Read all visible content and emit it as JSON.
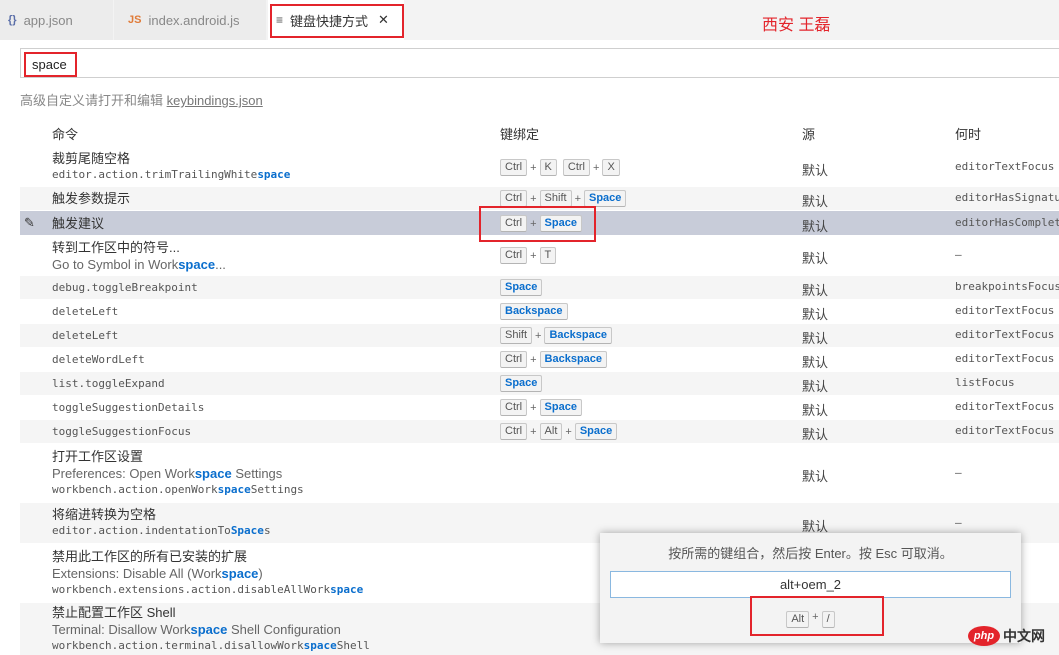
{
  "tabs": [
    {
      "icon": "{}",
      "label": "app.json"
    },
    {
      "icon": "JS",
      "label": "index.android.js"
    },
    {
      "icon": "≡",
      "label": "键盘快捷方式",
      "close": "✕"
    }
  ],
  "author_note": "西安 王磊",
  "search": {
    "value": "space"
  },
  "hint": {
    "text": "高级自定义请打开和编辑 ",
    "link": "keybindings.json"
  },
  "columns": {
    "command": "命令",
    "keybinding": "键绑定",
    "source": "源",
    "when": "何时"
  },
  "rows": [
    {
      "label": "裁剪尾随空格",
      "id_pre": "editor.action.trimTrailingWhite",
      "id_hl": "space",
      "id_post": "",
      "keys": [
        [
          "Ctrl",
          "K"
        ],
        [
          "Ctrl",
          "X"
        ]
      ],
      "source": "默认",
      "when": "editorTextFocus &&"
    },
    {
      "label": "触发参数提示",
      "keys": [
        [
          "Ctrl",
          "Shift",
          "Space"
        ]
      ],
      "source": "默认",
      "when": "editorHasSignatureHelp"
    },
    {
      "label": "触发建议",
      "keys": [
        [
          "Ctrl",
          "Space"
        ]
      ],
      "source": "默认",
      "when": "editorHasCompletionItemProvider"
    },
    {
      "label": "转到工作区中的符号...",
      "sub_pre": "Go to Symbol in Work",
      "sub_hl": "space",
      "sub_post": "...",
      "keys": [
        [
          "Ctrl",
          "T"
        ]
      ],
      "source": "默认",
      "when": "—"
    },
    {
      "id": "debug.toggleBreakpoint",
      "keys": [
        [
          "Space"
        ]
      ],
      "source": "默认",
      "when": "breakpointsFocused"
    },
    {
      "id": "deleteLeft",
      "keys": [
        [
          "Backspace"
        ]
      ],
      "source": "默认",
      "when": "editorTextFocus &&"
    },
    {
      "id": "deleteLeft",
      "keys": [
        [
          "Shift",
          "Backspace"
        ]
      ],
      "source": "默认",
      "when": "editorTextFocus &&"
    },
    {
      "id": "deleteWordLeft",
      "keys": [
        [
          "Ctrl",
          "Backspace"
        ]
      ],
      "source": "默认",
      "when": "editorTextFocus &&"
    },
    {
      "id": "list.toggleExpand",
      "keys": [
        [
          "Space"
        ]
      ],
      "source": "默认",
      "when": "listFocus"
    },
    {
      "id": "toggleSuggestionDetails",
      "keys": [
        [
          "Ctrl",
          "Space"
        ]
      ],
      "source": "默认",
      "when": "editorTextFocus &&"
    },
    {
      "id": "toggleSuggestionFocus",
      "keys": [
        [
          "Ctrl",
          "Alt",
          "Space"
        ]
      ],
      "source": "默认",
      "when": "editorTextFocus &&"
    },
    {
      "label": "打开工作区设置",
      "sub_pre": "Preferences: Open Work",
      "sub_hl": "space",
      "sub_post": " Settings",
      "id_pre": "workbench.action.openWork",
      "id_hl": "space",
      "id_post": "Settings",
      "keys": [],
      "source": "默认",
      "when": "—"
    },
    {
      "label": "将缩进转换为空格",
      "id_pre": "editor.action.indentationTo",
      "id_hl": "Space",
      "id_post": "s",
      "keys": [],
      "source": "默认",
      "when": "—"
    },
    {
      "label": "禁用此工作区的所有已安装的扩展",
      "sub_pre": "Extensions: Disable All (Work",
      "sub_hl": "space",
      "sub_post": ")",
      "id_pre": "workbench.extensions.action.disableAllWork",
      "id_hl": "space",
      "id_post": "",
      "keys": [],
      "source": "",
      "when": ""
    },
    {
      "label": "禁止配置工作区 Shell",
      "sub_pre": "Terminal: Disallow Work",
      "sub_hl": "space",
      "sub_post": " Shell Configuration",
      "id_pre": "workbench.action.terminal.disallowWork",
      "id_hl": "space",
      "id_post": "Shell",
      "keys": [],
      "source": "",
      "when": ""
    }
  ],
  "dialog": {
    "message": "按所需的键组合，然后按 Enter。按 Esc 可取消。",
    "input": "alt+oem_2",
    "keys": [
      "Alt",
      "/"
    ]
  },
  "watermark": {
    "logo": "php",
    "text": "中文网"
  },
  "colors": {
    "highlight": "#0a6ecd",
    "selected_row": "#c8ccd9",
    "annotation_red": "#e3242b"
  }
}
